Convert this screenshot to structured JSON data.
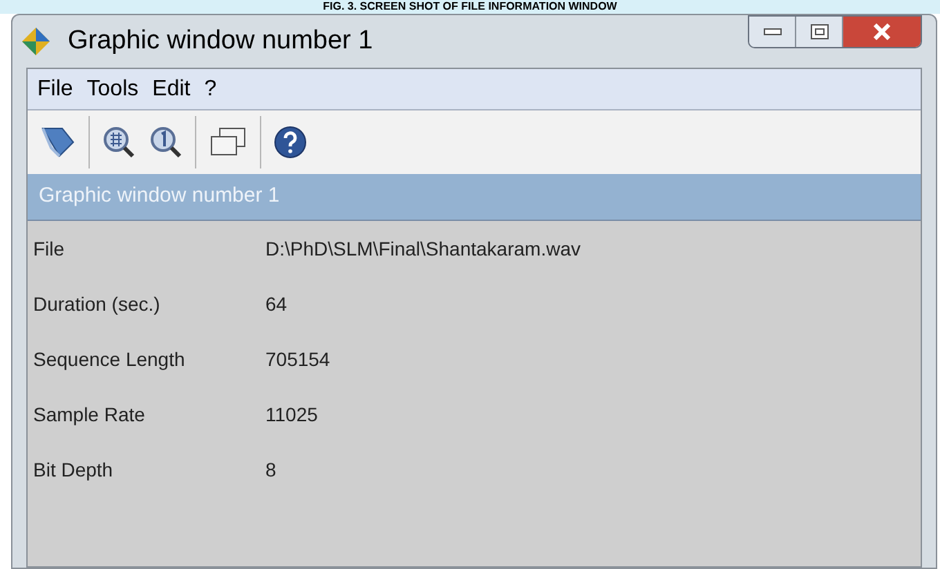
{
  "caption": "FIG. 3. SCREEN SHOT OF FILE INFORMATION WINDOW",
  "window": {
    "title": "Graphic window number 1"
  },
  "menu": [
    "File",
    "Tools",
    "Edit",
    "?"
  ],
  "toolbar": [
    {
      "kind": "rotate"
    },
    {
      "kind": "separator"
    },
    {
      "kind": "zoom-grid"
    },
    {
      "kind": "zoom-one"
    },
    {
      "kind": "separator"
    },
    {
      "kind": "windows"
    },
    {
      "kind": "separator"
    },
    {
      "kind": "help"
    }
  ],
  "panel": {
    "title": "Graphic window number 1"
  },
  "rows": [
    {
      "label": "File",
      "value": "D:\\PhD\\SLM\\Final\\Shantakaram.wav"
    },
    {
      "label": "Duration (sec.)",
      "value": "64"
    },
    {
      "label": "Sequence Length",
      "value": "705154"
    },
    {
      "label": "Sample Rate",
      "value": "11025"
    },
    {
      "label": "Bit Depth",
      "value": "8"
    }
  ]
}
